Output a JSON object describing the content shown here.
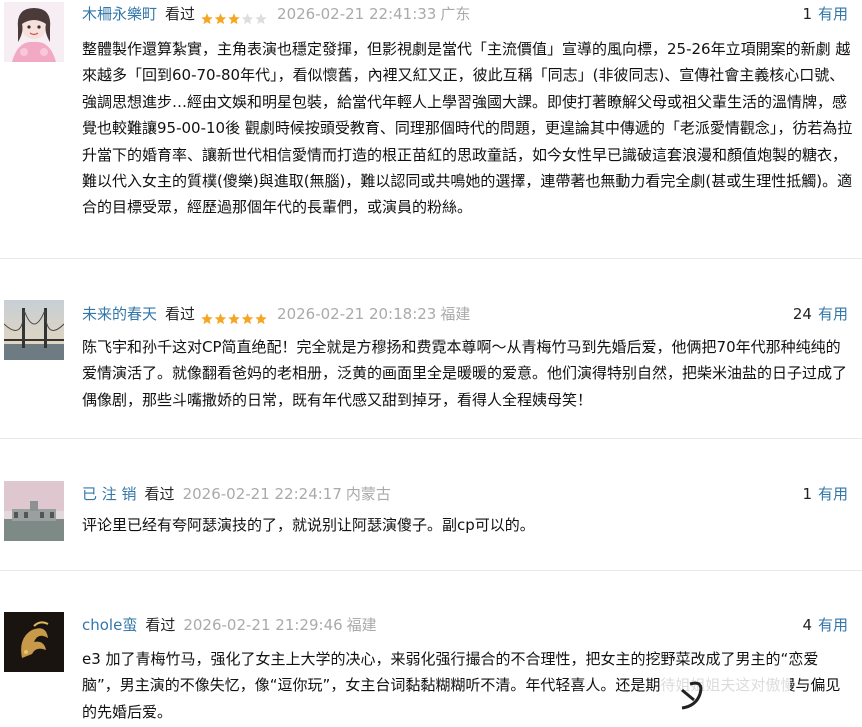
{
  "reviews": [
    {
      "user": "木柵永樂町",
      "watched": "看过",
      "rating": 3,
      "time": "2026-02-21 22:41:33",
      "location": "广东",
      "useful_count": "1",
      "useful_label": "有用",
      "text": "整體製作還算紮實，主角表演也穩定發揮，但影視劇是當代「主流價值」宣導的風向標，25-26年立項開案的新劇 越來越多「回到60-70-80年代」，看似懷舊，內裡又紅又正，彼此互稱「同志」(非彼同志)、宣傳社會主義核心口號、強調思想進步…經由文娛和明星包裝，給當代年輕人上學習強國大課。即使打著瞭解父母或祖父輩生活的溫情牌，感覺也較難讓95-00-10後 觀劇時候按頭受教育、同理那個時代的問題，更遑論其中傳遞的「老派愛情觀念」，彷若為拉升當下的婚育率、讓新世代相信愛情而打造的根正苗紅的思政童話，如今女性早已識破這套浪漫和顏值炮製的糖衣，難以代入女主的質樸(傻樂)與進取(無腦)，難以認同或共鳴她的選擇，連帶著也無動力看完全劇(甚或生理性抵觸)。適合的目標受眾，經歷過那個年代的長輩們，或演員的粉絲。"
    },
    {
      "user": "未来的春天",
      "watched": "看过",
      "rating": 5,
      "time": "2026-02-21 20:18:23",
      "location": "福建",
      "useful_count": "24",
      "useful_label": "有用",
      "text": "陈飞宇和孙千这对CP简直绝配！完全就是方穆扬和费霓本尊啊～从青梅竹马到先婚后爱，他俩把70年代那种纯纯的爱情演活了。就像翻看爸妈的老相册，泛黄的画面里全是暖暖的爱意。他们演得特别自然，把柴米油盐的日子过成了偶像剧，那些斗嘴撒娇的日常，既有年代感又甜到掉牙，看得人全程姨母笑！"
    },
    {
      "user": "已 注 销",
      "watched": "看过",
      "rating": 0,
      "time": "2026-02-21 22:24:17",
      "location": "内蒙古",
      "useful_count": "1",
      "useful_label": "有用",
      "text": "评论里已经有夸阿瑟演技的了，就说别让阿瑟演傻子。副cp可以的。"
    },
    {
      "user": "chole蛮",
      "watched": "看过",
      "rating": 0,
      "time": "2026-02-21 21:29:46",
      "location": "福建",
      "useful_count": "4",
      "useful_label": "有用",
      "text": "e3 加了青梅竹马，强化了女主上大学的决心，来弱化强行撮合的不合理性，把女主的挖野菜改成了男主的“恋爱脑”，男主演的不像失忆，像“逗你玩”，女主台词黏黏糊糊听不清。年代轻喜人。还是期待姐姐姐夫这对傲慢与偏见的先婚后爱。"
    }
  ],
  "colors": {
    "link": "#3377aa",
    "meta": "#aaaaaa",
    "star_on": "#f5a623",
    "star_off": "#dddddd",
    "separator": "#e8e8e8"
  }
}
